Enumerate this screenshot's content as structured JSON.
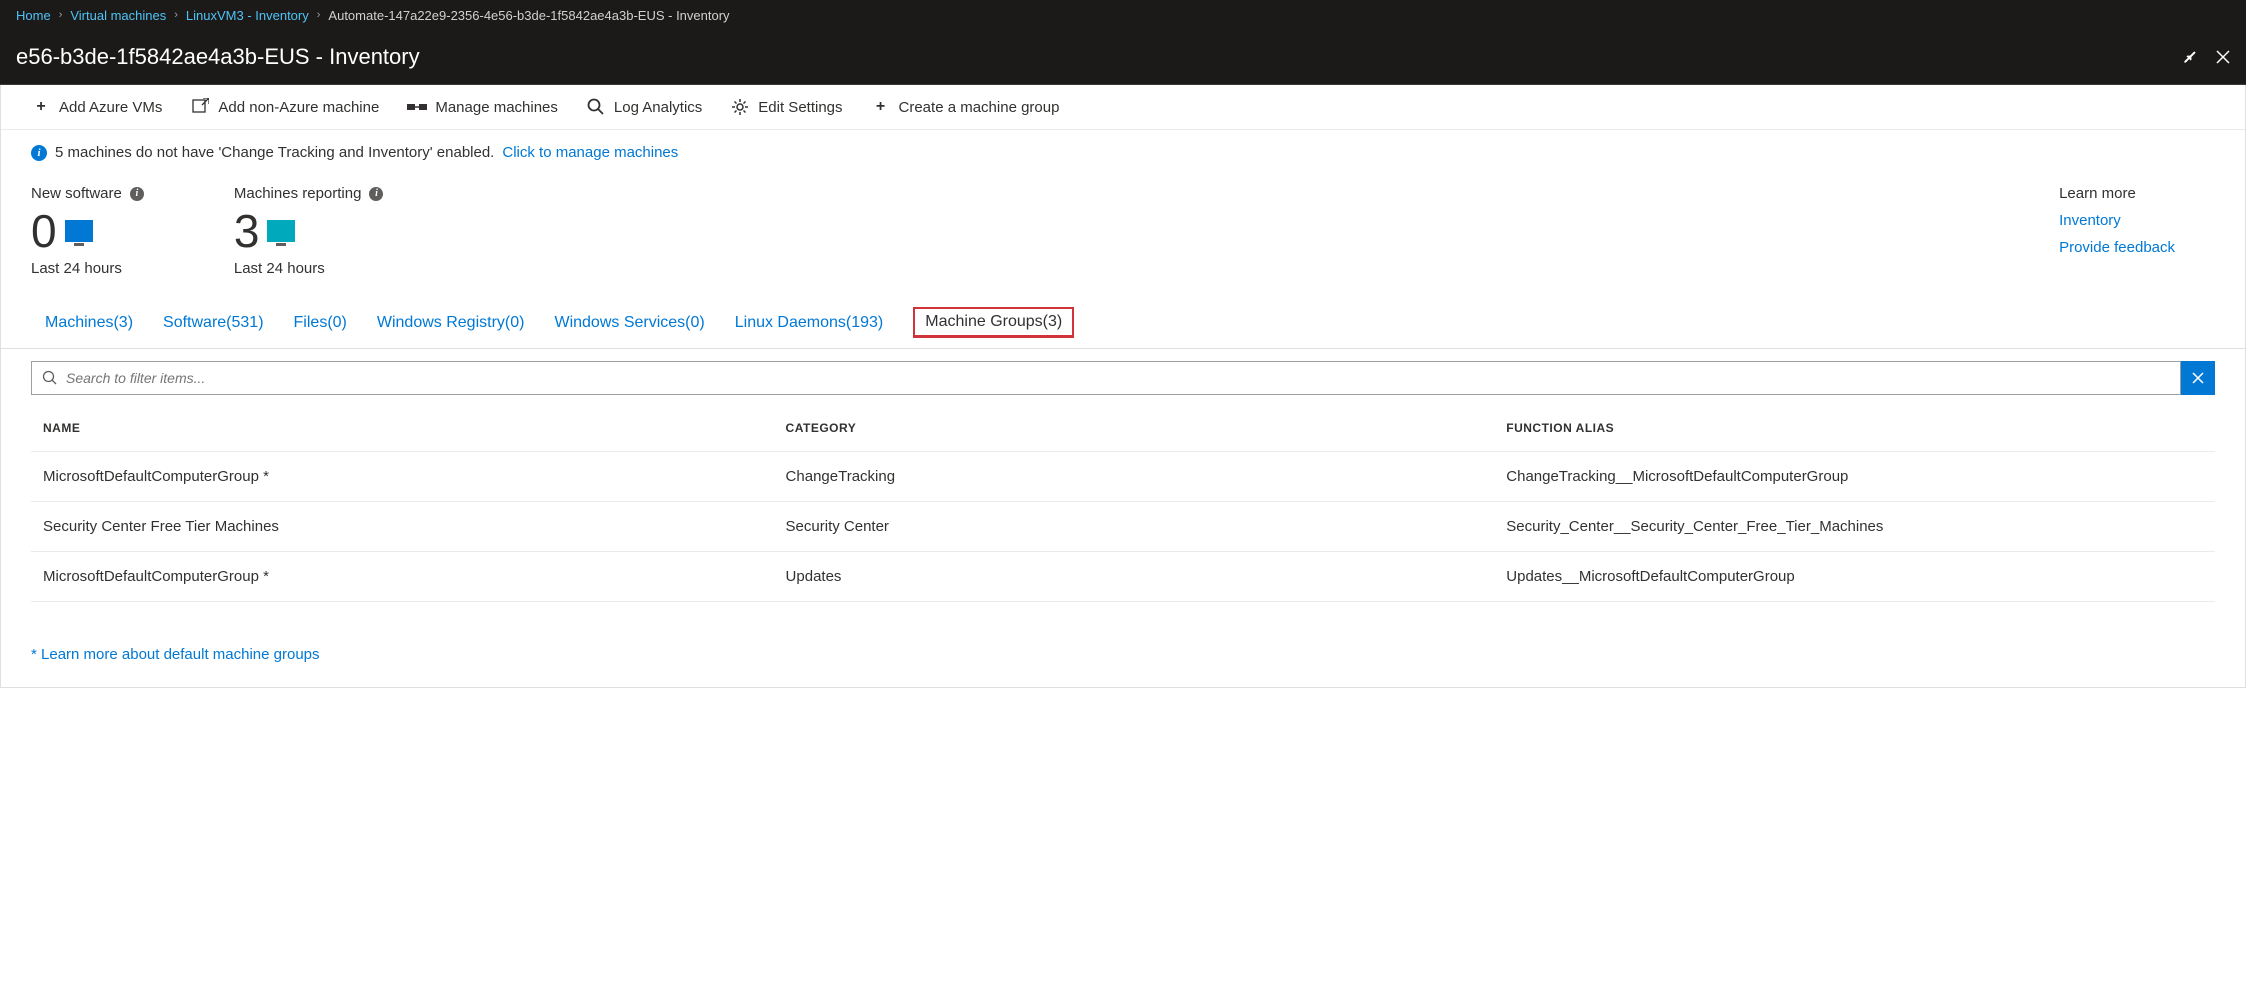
{
  "breadcrumb": {
    "items": [
      {
        "label": "Home"
      },
      {
        "label": "Virtual machines"
      },
      {
        "label": "LinuxVM3 - Inventory"
      }
    ],
    "current": "Automate-147a22e9-2356-4e56-b3de-1f5842ae4a3b-EUS - Inventory"
  },
  "title": "e56-b3de-1f5842ae4a3b-EUS - Inventory",
  "toolbar": {
    "add_vms": "Add Azure VMs",
    "add_non_azure": "Add non-Azure machine",
    "manage_machines": "Manage machines",
    "log_analytics": "Log Analytics",
    "edit_settings": "Edit Settings",
    "create_group": "Create a machine group"
  },
  "info_banner": {
    "text": "5 machines do not have 'Change Tracking and Inventory' enabled.",
    "link": "Click to manage machines"
  },
  "stats": {
    "new_software": {
      "label": "New software",
      "value": "0",
      "sub": "Last 24 hours"
    },
    "machines_reporting": {
      "label": "Machines reporting",
      "value": "3",
      "sub": "Last 24 hours"
    }
  },
  "learn_more": {
    "title": "Learn more",
    "inventory": "Inventory",
    "feedback": "Provide feedback"
  },
  "tabs": [
    {
      "label": "Machines(3)"
    },
    {
      "label": "Software(531)"
    },
    {
      "label": "Files(0)"
    },
    {
      "label": "Windows Registry(0)"
    },
    {
      "label": "Windows Services(0)"
    },
    {
      "label": "Linux Daemons(193)"
    },
    {
      "label": "Machine Groups(3)",
      "active": true
    }
  ],
  "search": {
    "placeholder": "Search to filter items..."
  },
  "table": {
    "headers": {
      "name": "NAME",
      "category": "CATEGORY",
      "alias": "FUNCTION ALIAS"
    },
    "rows": [
      {
        "name": "MicrosoftDefaultComputerGroup *",
        "category": "ChangeTracking",
        "alias": "ChangeTracking__MicrosoftDefaultComputerGroup"
      },
      {
        "name": "Security Center Free Tier Machines",
        "category": "Security Center",
        "alias": "Security_Center__Security_Center_Free_Tier_Machines"
      },
      {
        "name": "MicrosoftDefaultComputerGroup *",
        "category": "Updates",
        "alias": "Updates__MicrosoftDefaultComputerGroup"
      }
    ]
  },
  "footer_link": "* Learn more about default machine groups"
}
